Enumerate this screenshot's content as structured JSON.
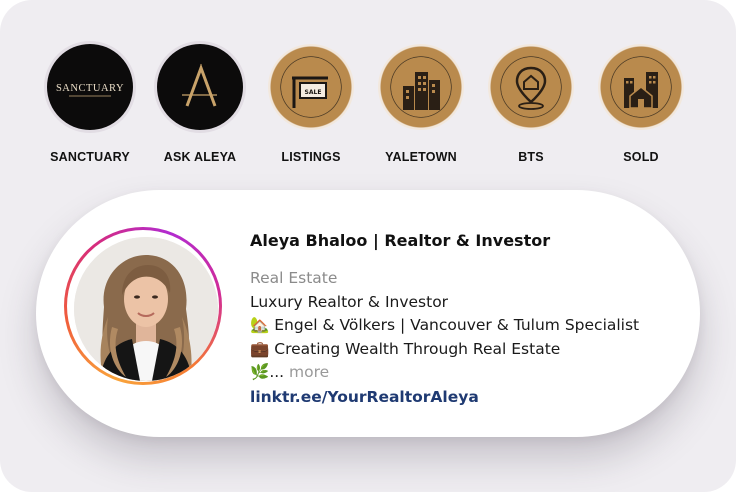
{
  "highlights": [
    {
      "label": "SANCTUARY",
      "style": "black",
      "icon": "sanctuary-wordmark",
      "cover_text": "SANCTUARY"
    },
    {
      "label": "ASK ALEYA",
      "style": "black",
      "icon": "a-monogram"
    },
    {
      "label": "LISTINGS",
      "style": "gold",
      "icon": "sale-sign-icon",
      "cover_text": "SALE"
    },
    {
      "label": "YALETOWN",
      "style": "gold",
      "icon": "city-buildings-icon"
    },
    {
      "label": "BTS",
      "style": "gold",
      "icon": "house-location-pin-icon"
    },
    {
      "label": "SOLD",
      "style": "gold",
      "icon": "house-buildings-icon"
    }
  ],
  "profile": {
    "name": "Aleya Bhaloo | Realtor & Investor",
    "category": "Real Estate",
    "bio": [
      {
        "emoji": "",
        "text": "Luxury Realtor & Investor"
      },
      {
        "emoji": "🏡",
        "text": "Engel & Völkers | Vancouver & Tulum Specialist"
      },
      {
        "emoji": "💼",
        "text": "Creating Wealth Through Real Estate"
      }
    ],
    "truncated": {
      "emoji": "🌿",
      "ellipsis": "...",
      "more": "more"
    },
    "link": "linktr.ee/YourRealtorAleya"
  },
  "colors": {
    "panel": "#efedf1",
    "gold": "#b98a4d",
    "link": "#1f3a72",
    "story_ring": [
      "#f9a43b",
      "#d72c7b",
      "#b12bd0"
    ]
  }
}
